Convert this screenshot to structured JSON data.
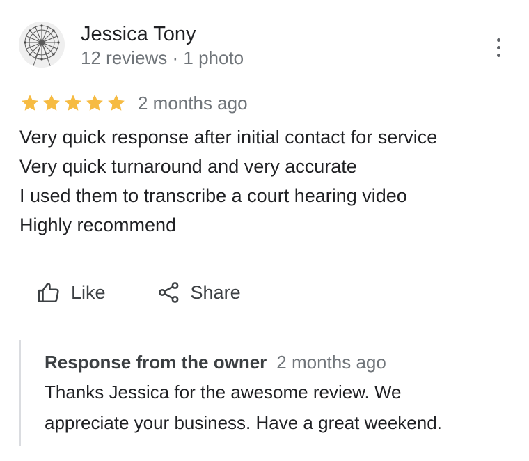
{
  "reviewer": {
    "name": "Jessica Tony",
    "meta": "12 reviews · 1 photo"
  },
  "review": {
    "rating": 5,
    "max_rating": 5,
    "time": "2 months ago",
    "lines": [
      "Very quick response after initial contact for service",
      "Very quick turnaround and very accurate",
      "I used them to transcribe a court hearing video",
      "Highly recommend"
    ]
  },
  "actions": {
    "like_label": "Like",
    "share_label": "Share"
  },
  "owner_response": {
    "title": "Response from the owner",
    "time": "2 months ago",
    "lines": [
      "Thanks Jessica for the awesome review.  We",
      "appreciate your business.  Have a great weekend."
    ]
  },
  "colors": {
    "star": "#f6bb42",
    "text_primary": "#202124",
    "text_secondary": "#70757a",
    "divider": "#dadce0"
  },
  "icons": {
    "more": "more-vert-icon",
    "like": "thumb-up-icon",
    "share": "share-icon"
  }
}
